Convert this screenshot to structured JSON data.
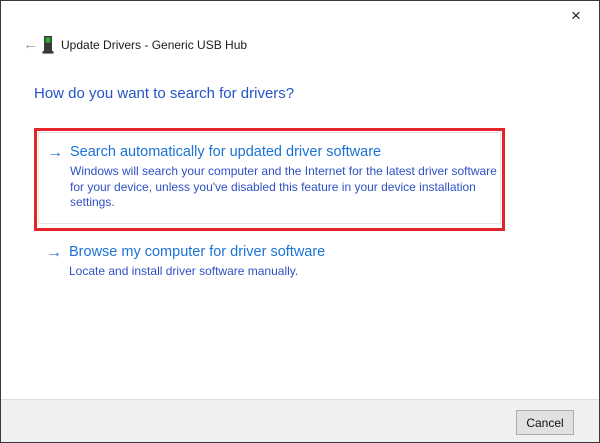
{
  "window": {
    "title": "Update Drivers - Generic USB Hub"
  },
  "icons": {
    "close": "×",
    "back": "←",
    "option_arrow": "→"
  },
  "main": {
    "heading": "How do you want to search for drivers?",
    "options": [
      {
        "title": "Search automatically for updated driver software",
        "description_lines": [
          "Windows will search your computer and the Internet for the latest driver software",
          "for your device, unless you've disabled this feature in your device installation",
          "settings."
        ]
      },
      {
        "title": "Browse my computer for driver software",
        "description_lines": [
          "Locate and install driver software manually."
        ]
      }
    ]
  },
  "footer": {
    "cancel_label": "Cancel"
  },
  "colors": {
    "heading": "#2454c7",
    "link-title": "#1a73d4",
    "link-desc": "#2e51c4",
    "arrow": "#2a6fd0",
    "annotation": "#e2242b"
  }
}
